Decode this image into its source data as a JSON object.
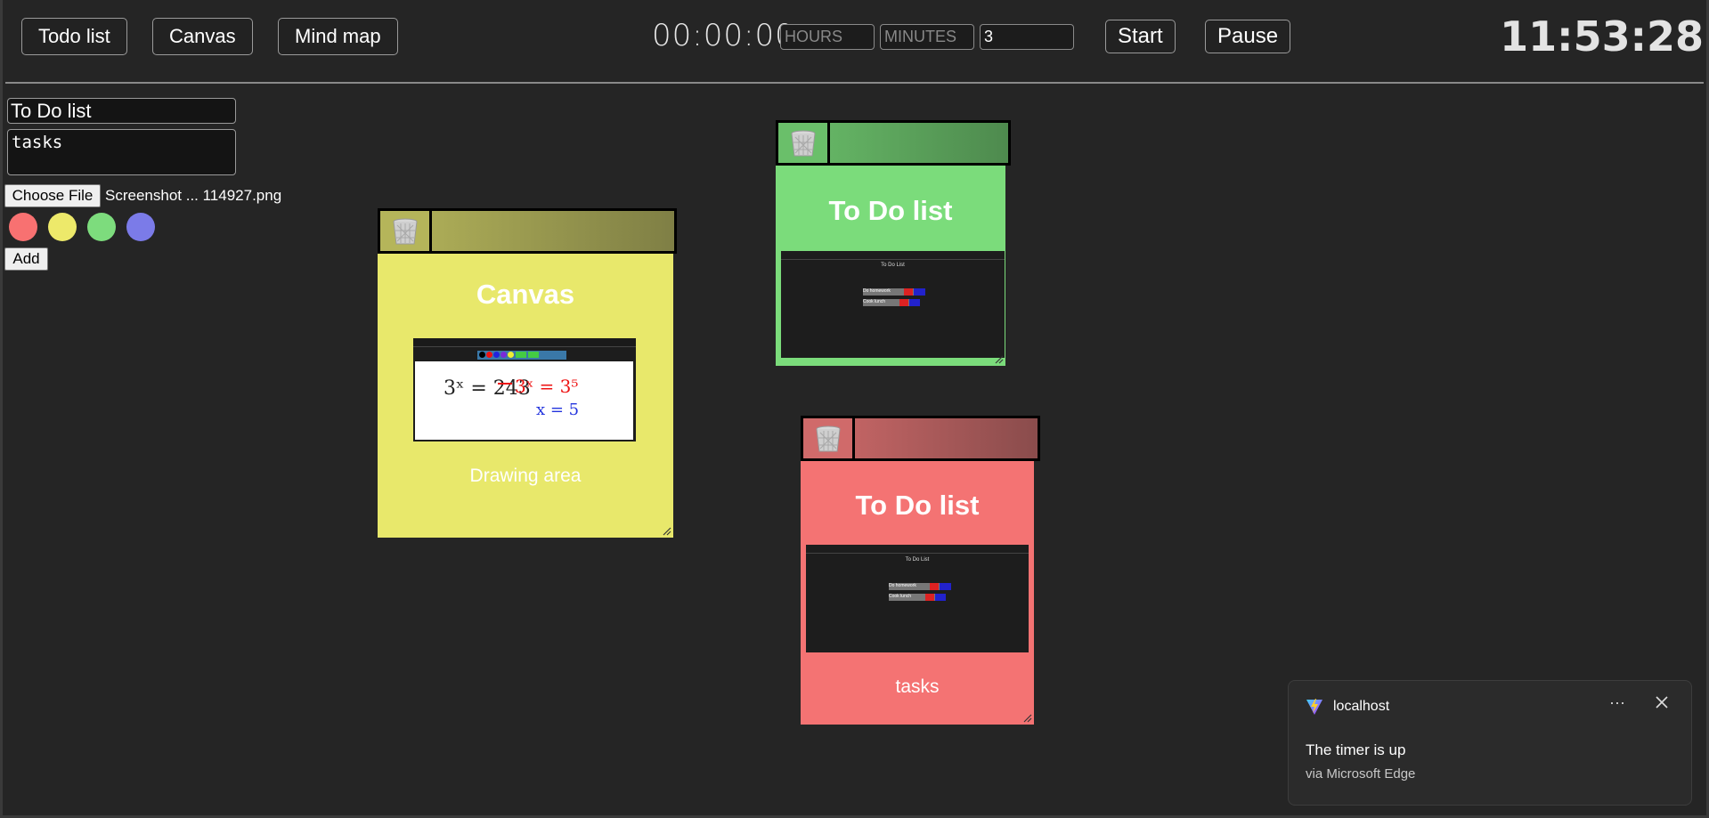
{
  "nav": {
    "todo_label": "Todo list",
    "canvas_label": "Canvas",
    "mindmap_label": "Mind map"
  },
  "timer": {
    "display": "00:00:00",
    "hours_placeholder": "HOURS",
    "minutes_placeholder": "MINUTES",
    "seconds_value": "3",
    "start_label": "Start",
    "pause_label": "Pause"
  },
  "clock": "11:53:28",
  "form": {
    "title_value": "To Do list",
    "description_value": "tasks",
    "choose_file_label": "Choose File",
    "file_name": "Screenshot ... 114927.png",
    "color_options": [
      "#f87171",
      "#ede96a",
      "#7ddc7d",
      "#7b7be8"
    ],
    "add_label": "Add"
  },
  "cards": [
    {
      "title": "Canvas",
      "description": "Drawing area",
      "color": "#e8e86b",
      "header_gradient": [
        "#b5b55a",
        "#7f7f45"
      ],
      "thumb": {
        "equation": "3ˣ = 243",
        "answer": "3ˣ = 3⁵",
        "result": "x = 5"
      }
    },
    {
      "title": "To Do list",
      "description": "",
      "color": "#7bdc7b",
      "header_gradient": [
        "#6abf6a",
        "#4e8a4e"
      ],
      "thumb": {
        "title": "To Do List",
        "rows": [
          "Do homework",
          "Cook lunch"
        ]
      }
    },
    {
      "title": "To Do list",
      "description": "tasks",
      "color": "#f47373",
      "header_gradient": [
        "#d06a6a",
        "#8a4c4c"
      ],
      "thumb": {
        "title": "To Do List",
        "rows": [
          "Do homework",
          "Cook lunch"
        ]
      }
    }
  ],
  "notification": {
    "app": "localhost",
    "message": "The timer is up",
    "source": "via Microsoft Edge",
    "more_glyph": "···"
  }
}
